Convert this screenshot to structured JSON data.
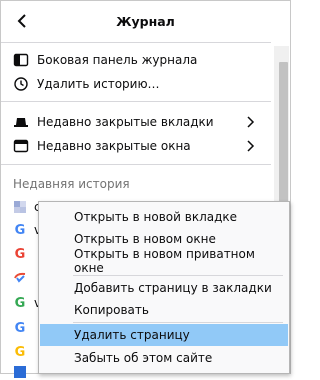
{
  "header": {
    "title": "Журнал"
  },
  "menu": {
    "items": [
      {
        "label": "Боковая панель журнала",
        "icon": "sidebar-icon"
      },
      {
        "label": "Удалить историю…",
        "icon": "clear-history-icon"
      },
      {
        "label": "Недавно закрытые вкладки",
        "icon": "closed-tabs-icon"
      },
      {
        "label": "Недавно закрытые окна",
        "icon": "closed-windows-icon"
      }
    ],
    "section_label": "Недавняя история"
  },
  "history": {
    "items": [
      {
        "icon": "site-icon",
        "text": "c"
      },
      {
        "icon": "google-icon",
        "text": "v"
      },
      {
        "icon": "google-icon",
        "text": ""
      },
      {
        "icon": "checkmark-site-icon",
        "text": ""
      },
      {
        "icon": "google-icon",
        "text": "v"
      },
      {
        "icon": "google-icon",
        "text": ""
      },
      {
        "icon": "google-icon",
        "text": ""
      },
      {
        "icon": "site-icon",
        "text": ""
      }
    ]
  },
  "context_menu": {
    "items": [
      {
        "label": "Открыть в новой вкладке"
      },
      {
        "label": "Открыть в новом окне"
      },
      {
        "label": "Открыть в новом приватном окне"
      },
      {
        "label": "Добавить страницу в закладки"
      },
      {
        "label": "Копировать"
      },
      {
        "label": "Удалить страницу",
        "active": true
      },
      {
        "label": "Забыть об этом сайте"
      }
    ]
  },
  "colors": {
    "highlight": "#91c9f7",
    "separator": "#d7d7db",
    "muted_text": "#737373"
  }
}
